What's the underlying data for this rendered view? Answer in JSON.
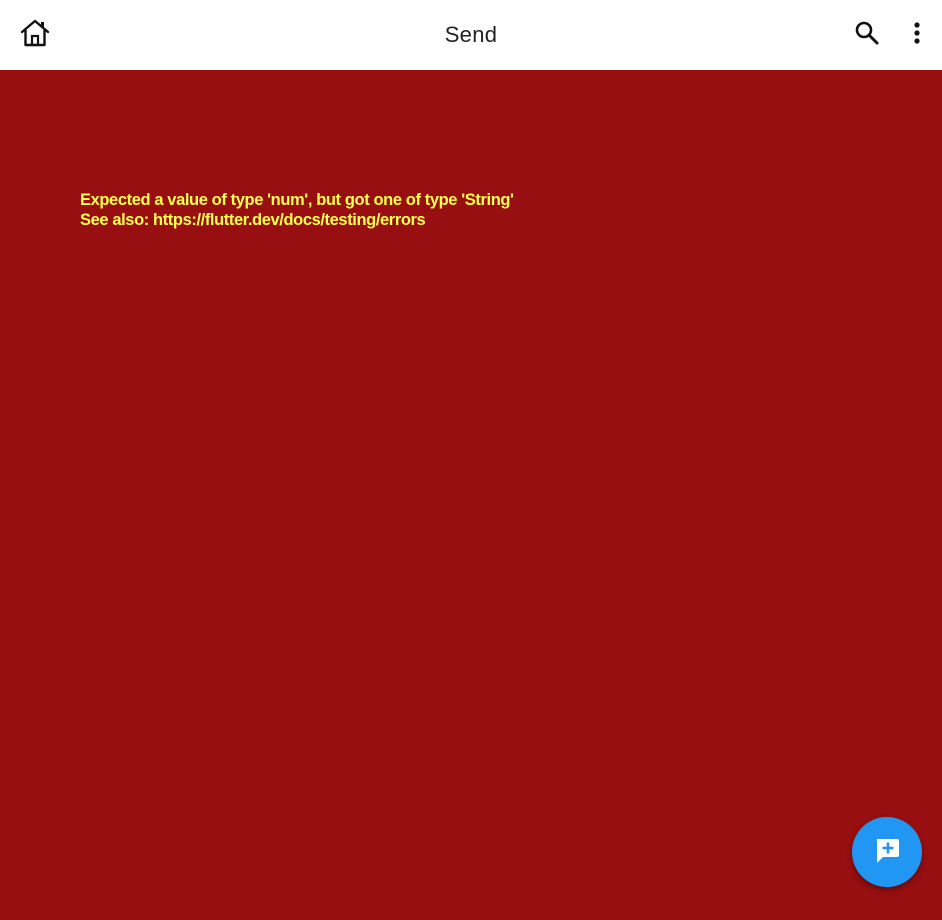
{
  "appbar": {
    "title": "Send",
    "icons": {
      "home": "home-icon",
      "search": "search-icon",
      "more": "more-vert-icon"
    }
  },
  "error": {
    "message": "Expected a value of type 'num', but got one of type 'String'",
    "see_also": "See also: https://flutter.dev/docs/testing/errors"
  },
  "fab": {
    "icon": "add-comment-icon"
  },
  "colors": {
    "background": "#970F10",
    "appbar": "#FFFFFF",
    "error_text": "#FFFF4D",
    "fab": "#2196F3"
  }
}
